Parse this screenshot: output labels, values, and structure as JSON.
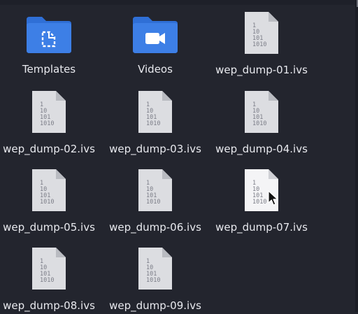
{
  "file_manager": {
    "items": [
      {
        "kind": "folder",
        "icon": "folder-templates-icon",
        "label": "Templates"
      },
      {
        "kind": "folder",
        "icon": "folder-videos-icon",
        "label": "Videos"
      },
      {
        "kind": "file",
        "icon": "binary-file-icon",
        "label": "wep_dump-01.ivs"
      },
      {
        "kind": "file",
        "icon": "binary-file-icon",
        "label": "wep_dump-02.ivs"
      },
      {
        "kind": "file",
        "icon": "binary-file-icon",
        "label": "wep_dump-03.ivs"
      },
      {
        "kind": "file",
        "icon": "binary-file-icon",
        "label": "wep_dump-04.ivs"
      },
      {
        "kind": "file",
        "icon": "binary-file-icon",
        "label": "wep_dump-05.ivs"
      },
      {
        "kind": "file",
        "icon": "binary-file-icon",
        "label": "wep_dump-06.ivs"
      },
      {
        "kind": "file",
        "icon": "binary-file-icon",
        "label": "wep_dump-07.ivs"
      },
      {
        "kind": "file",
        "icon": "binary-file-icon",
        "label": "wep_dump-08.ivs"
      },
      {
        "kind": "file",
        "icon": "binary-file-icon",
        "label": "wep_dump-09.ivs"
      }
    ],
    "binary_icon_lines": [
      "1",
      "10",
      "101",
      "1010"
    ],
    "hovered_item": "wep_dump-07.ivs",
    "colors": {
      "background": "#23252e",
      "folder": "#3d7fe6",
      "label": "#e8e9ee"
    }
  }
}
